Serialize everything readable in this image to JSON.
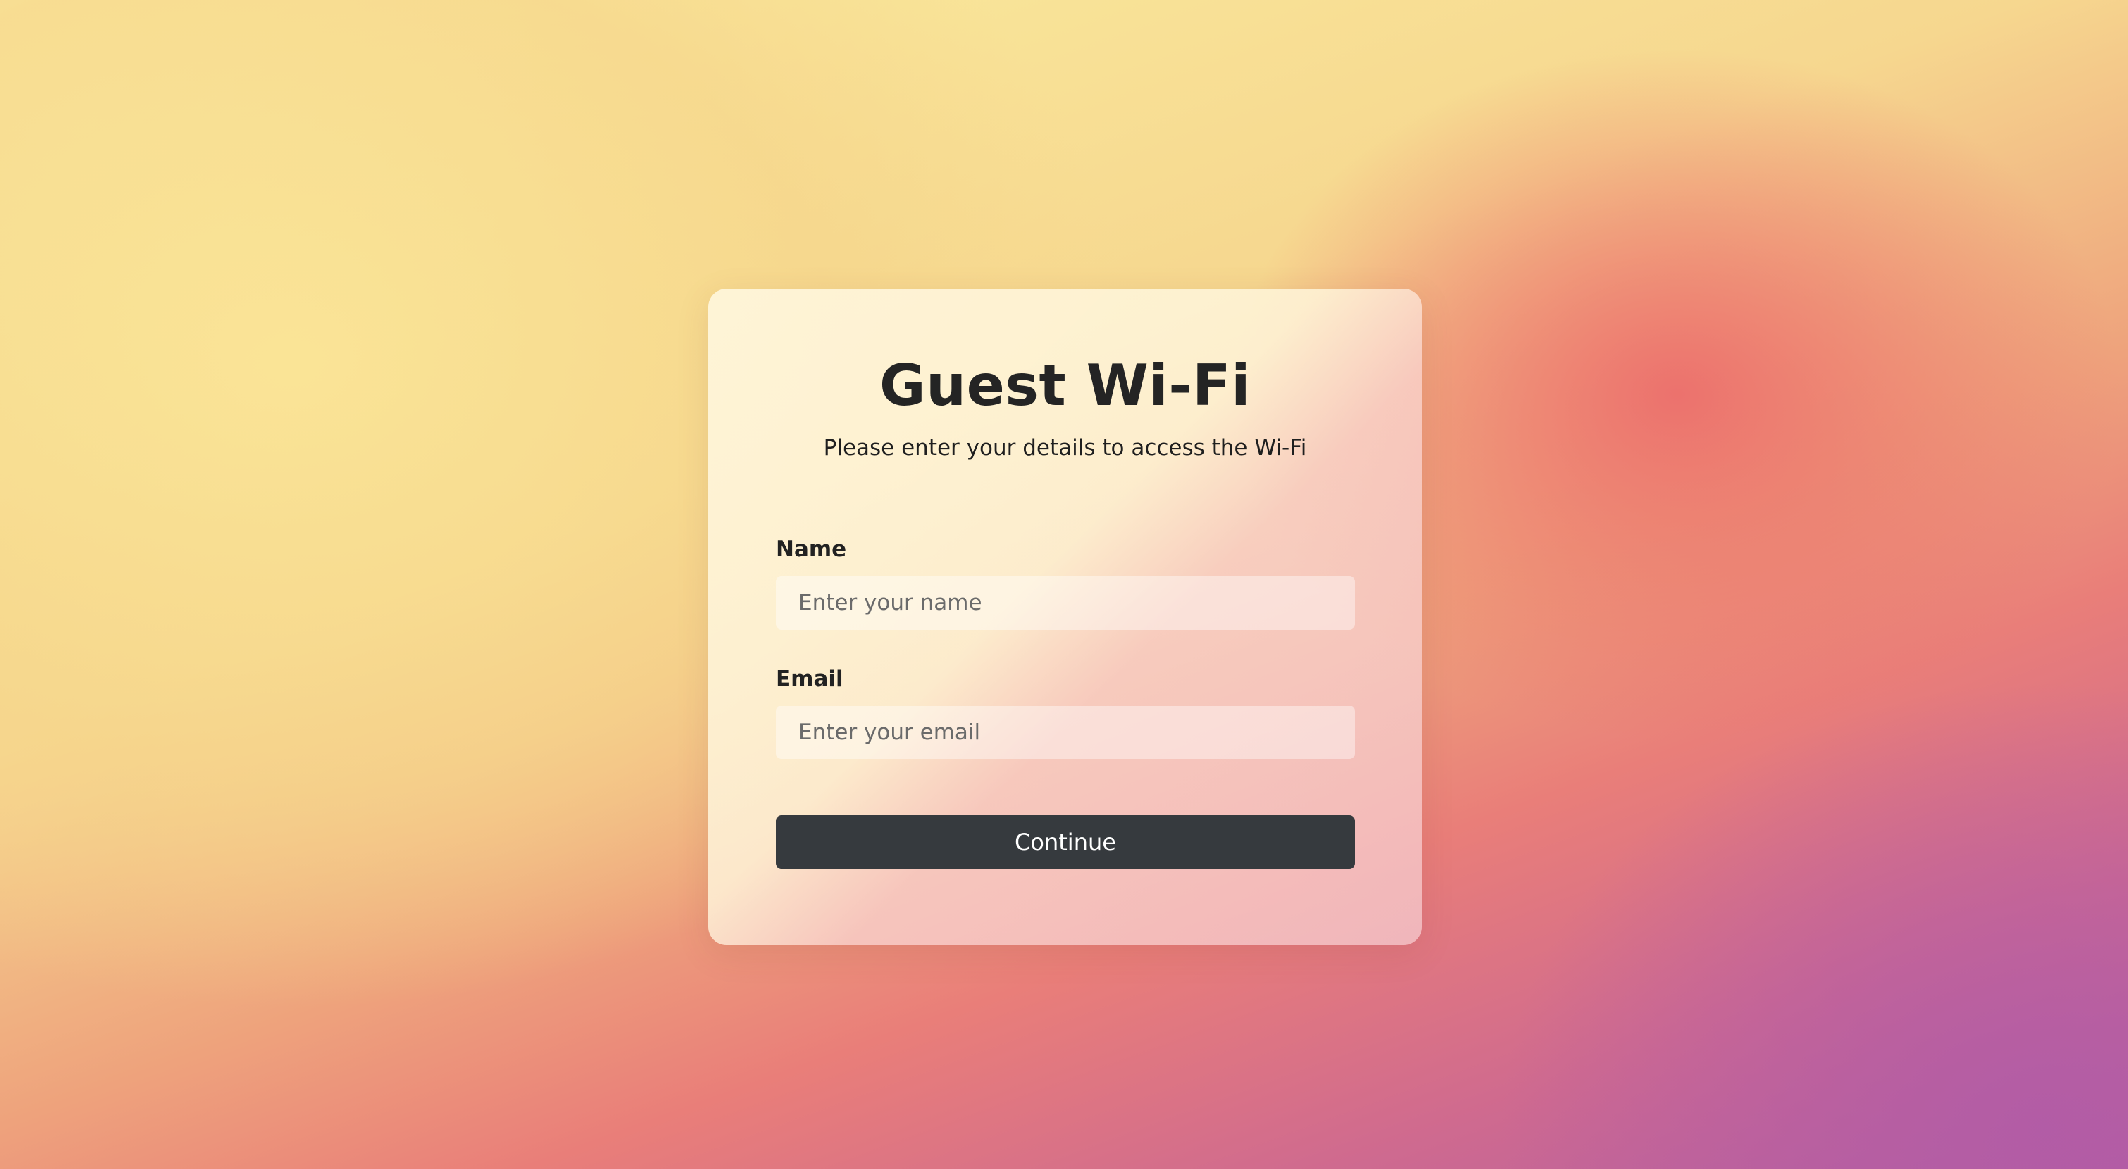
{
  "background": {
    "colors": [
      "#fbefa0",
      "#f6d78f",
      "#ec6e6c",
      "#b45ea2"
    ]
  },
  "card": {
    "title": "Guest Wi-Fi",
    "subtitle": "Please enter your details to access the Wi-Fi"
  },
  "form": {
    "name": {
      "label": "Name",
      "placeholder": "Enter your name",
      "value": ""
    },
    "email": {
      "label": "Email",
      "placeholder": "Enter your email",
      "value": ""
    },
    "submit_label": "Continue"
  },
  "theme": {
    "button_color": "#363a3e",
    "text_color": "#242424"
  }
}
